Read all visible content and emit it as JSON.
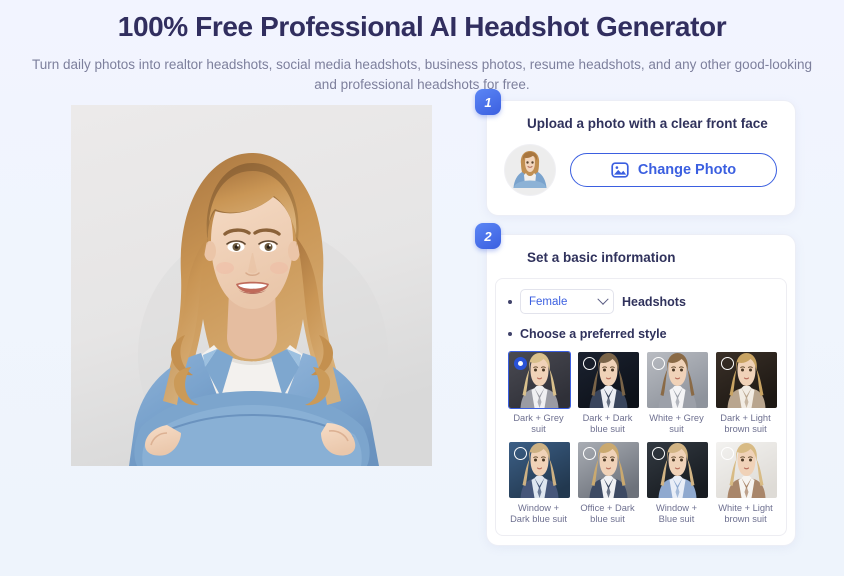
{
  "hero": {
    "title": "100% Free Professional AI Headshot Generator",
    "subtitle": "Turn daily photos into realtor headshots, social media headshots, business photos, resume headshots, and any other good-looking and professional headshots for free."
  },
  "preview": {
    "alt": "Smiling young woman with long wavy blonde hair wearing a denim jacket over a white top, arms crossed, on a light grey background"
  },
  "step1": {
    "badge": "1",
    "title": "Upload a photo with a clear front face",
    "avatar_alt": "Uploaded photo thumbnail",
    "change_button": "Change Photo",
    "change_icon": "image-icon"
  },
  "step2": {
    "badge": "2",
    "title": "Set a basic information",
    "gender_value": "Female",
    "gender_options": [
      "Female"
    ],
    "gender_suffix": "Headshots",
    "style_label": "Choose a preferred style",
    "styles": [
      {
        "label": "Dark + Grey suit",
        "selected": true
      },
      {
        "label": "Dark + Dark blue suit",
        "selected": false
      },
      {
        "label": "White + Grey suit",
        "selected": false
      },
      {
        "label": "Dark + Light brown suit",
        "selected": false
      },
      {
        "label": "Window + Dark blue suit",
        "selected": false
      },
      {
        "label": "Office + Dark blue suit",
        "selected": false
      },
      {
        "label": "Window + Blue suit",
        "selected": false
      },
      {
        "label": "White + Light brown suit",
        "selected": false
      }
    ]
  },
  "colors": {
    "accent": "#3b5fe0",
    "title": "#312e5f",
    "muted": "#7d7f9c",
    "page_bg": "#f2f4ff"
  }
}
